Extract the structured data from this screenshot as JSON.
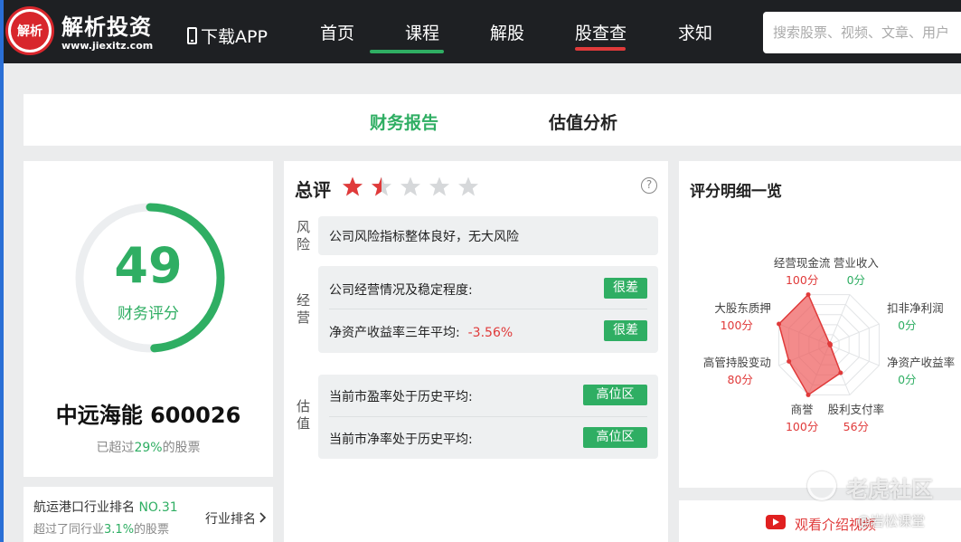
{
  "brand": {
    "name": "解析投资",
    "url": "www.jiexitz.com",
    "logo_text": "解析"
  },
  "header": {
    "download": "下载APP",
    "nav": [
      "首页",
      "课程",
      "解股",
      "股查查",
      "求知"
    ],
    "active_nav": "股查查",
    "search_placeholder": "搜索股票、视频、文章、用户"
  },
  "tabs": {
    "items": [
      "财务报告",
      "估值分析"
    ],
    "active": "财务报告"
  },
  "score": {
    "value": "49",
    "label": "财务评分",
    "fraction": 0.49,
    "stock": "中远海能 600026",
    "beat_prefix": "已超过",
    "beat_pct": "29%",
    "beat_suffix": "的股票"
  },
  "rank": {
    "title": "航运港口行业排名",
    "no": "NO.31",
    "sub_prefix": "超过了同行业",
    "sub_pct": "3.1%",
    "sub_suffix": "的股票",
    "link": "行业排名"
  },
  "summary": {
    "title": "总评",
    "stars": 1.5,
    "max_stars": 5,
    "help": "?",
    "risk": {
      "label": "风险",
      "text": "公司风险指标整体良好，无大风险"
    },
    "ops": {
      "label": "经营",
      "row1": "公司经营情况及稳定程度:",
      "row1_tag": "很差",
      "row2": "净资产收益率三年平均:",
      "row2_value": "-3.56%",
      "row2_tag": "很差"
    },
    "valuation": {
      "label": "估值",
      "row1": "当前市盈率处于历史平均:",
      "row1_tag": "高位区",
      "row2": "当前市净率处于历史平均:",
      "row2_tag": "高位区"
    }
  },
  "radar": {
    "title": "评分明细一览",
    "axes": [
      {
        "name": "营业收入",
        "score": "0分",
        "value": 0,
        "pos": "right"
      },
      {
        "name": "扣非净利润",
        "score": "0分",
        "value": 0,
        "pos": "right"
      },
      {
        "name": "净资产收益率",
        "score": "0分",
        "value": 0,
        "pos": "right"
      },
      {
        "name": "股利支付率",
        "score": "56分",
        "value": 56,
        "pos": "right"
      },
      {
        "name": "商誉",
        "score": "100分",
        "value": 100,
        "pos": "left"
      },
      {
        "name": "高管持股变动",
        "score": "80分",
        "value": 80,
        "pos": "left"
      },
      {
        "name": "大股东质押",
        "score": "100分",
        "value": 100,
        "pos": "left"
      },
      {
        "name": "经营现金流",
        "score": "100分",
        "value": 100,
        "pos": "left"
      }
    ],
    "video_link": "观看介绍视频"
  },
  "watermark": {
    "main": "老虎社区",
    "sub": "@岩松课堂"
  },
  "colors": {
    "green": "#2fae63",
    "red": "#e03a3a",
    "dark": "#1e2023"
  }
}
